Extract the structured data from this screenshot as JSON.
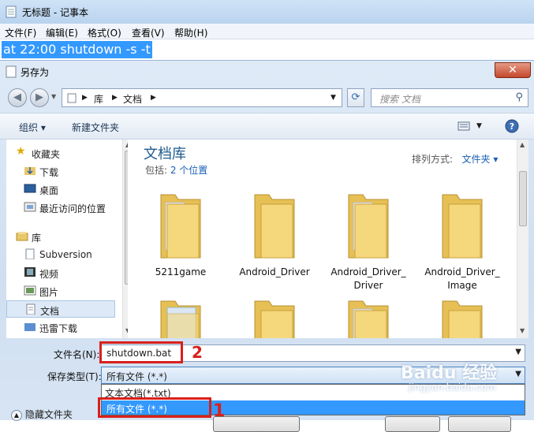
{
  "notepad": {
    "title": "无标题 - 记事本",
    "menu": [
      "文件(F)",
      "编辑(E)",
      "格式(O)",
      "查看(V)",
      "帮助(H)"
    ],
    "text": "at 22:00 shutdown -s -t"
  },
  "dialog": {
    "title": "另存为",
    "close": "✕",
    "breadcrumb": [
      "库",
      "文档"
    ],
    "search_placeholder": "搜索 文档",
    "toolbar": {
      "organize": "组织 ▾",
      "new_folder": "新建文件夹"
    },
    "nav": [
      {
        "label": "收藏夹",
        "type": "header"
      },
      {
        "label": "下载"
      },
      {
        "label": "桌面"
      },
      {
        "label": "最近访问的位置"
      },
      {
        "label": "库",
        "type": "header"
      },
      {
        "label": "Subversion"
      },
      {
        "label": "视频"
      },
      {
        "label": "图片"
      },
      {
        "label": "文档",
        "selected": true
      },
      {
        "label": "迅雷下载"
      }
    ],
    "library": {
      "title": "文档库",
      "includes_prefix": "包括: ",
      "includes_link": "2 个位置",
      "sort_label": "排列方式:",
      "sort_value": "文件夹 ▾"
    },
    "folders": [
      {
        "name": "5211game"
      },
      {
        "name": "Android_Driver"
      },
      {
        "name": "Android_Driver_ Driver"
      },
      {
        "name": "Android_Driver_ Image"
      }
    ],
    "filename_label": "文件名(N):",
    "filename_value": "shutdown.bat",
    "filetype_label": "保存类型(T):",
    "filetype_value": "所有文件 (*.*)",
    "filetype_options": [
      "文本文档(*.txt)",
      "所有文件  (*.*)"
    ],
    "hide_folders": "隐藏文件夹",
    "annotation_1": "1",
    "annotation_2": "2",
    "watermark": "Baidu 经验",
    "watermark_url": "jingyan.baidu.com"
  }
}
